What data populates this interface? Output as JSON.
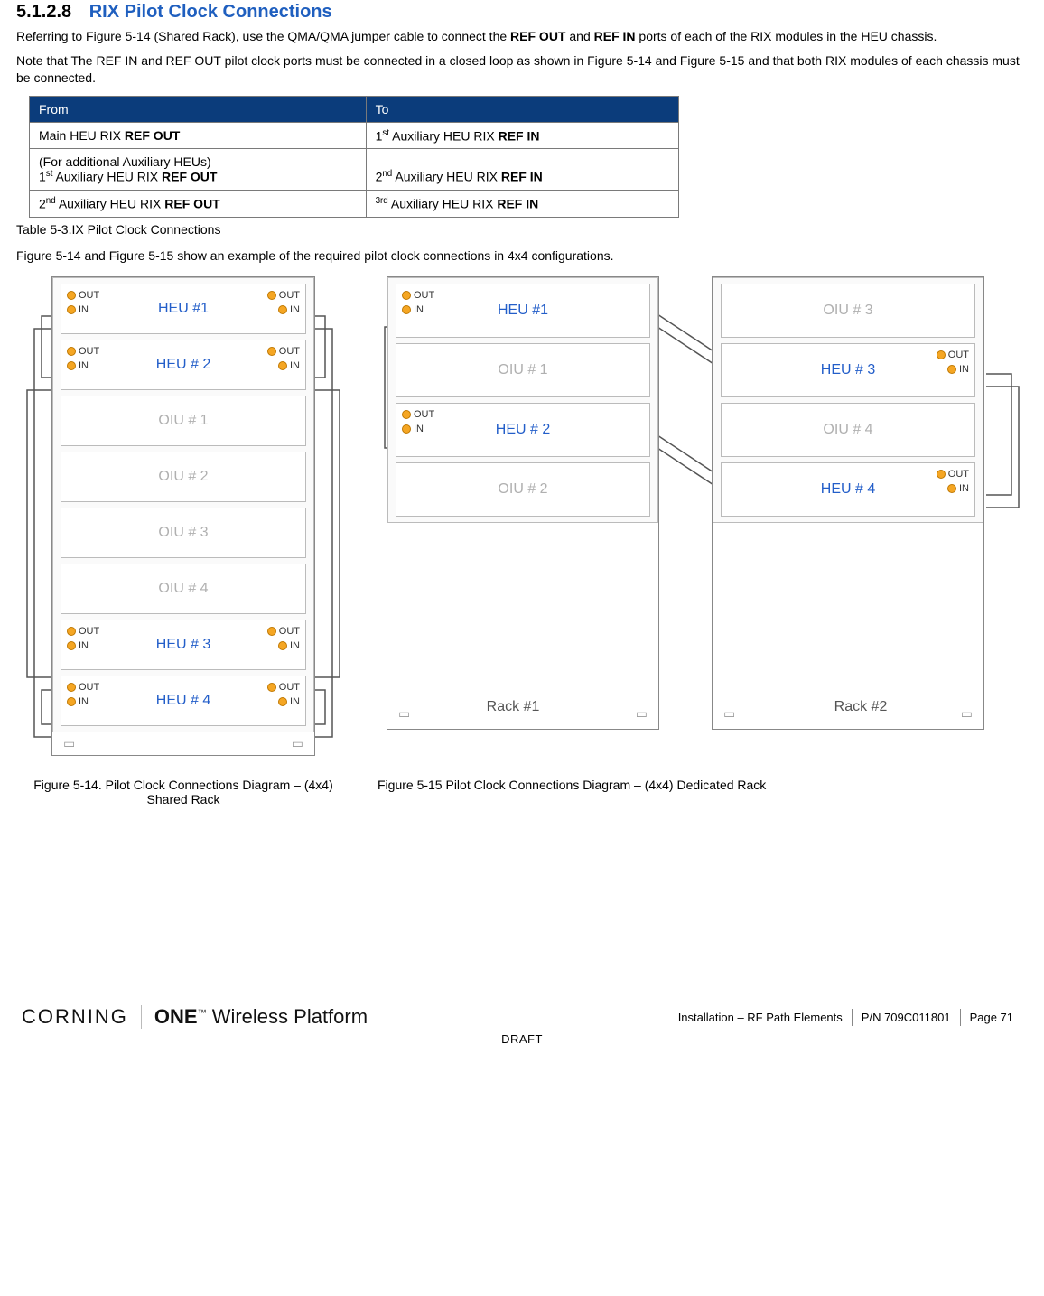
{
  "section": {
    "number": "5.1.2.8",
    "title": "RIX Pilot Clock Connections"
  },
  "para1_a": "Referring to Figure 5-14 (Shared Rack), use the QMA/QMA jumper cable to connect the ",
  "para1_b": " and ",
  "para1_c": " ports of each of the RIX modules in the HEU chassis.",
  "ref_out": "REF OUT",
  "ref_in": "REF IN",
  "para2": "Note that The REF IN and REF OUT pilot clock ports must be connected in a closed loop as shown in Figure 5-14 and Figure 5-15 and that both RIX modules of each chassis must be connected.",
  "table": {
    "headers": [
      "From",
      "To"
    ],
    "rows": [
      {
        "from_pre": "Main HEU RIX ",
        "from_bold": "REF OUT",
        "to_pre": "1",
        "to_sup": "st",
        "to_mid": " Auxiliary HEU RIX ",
        "to_bold": "REF IN"
      },
      {
        "from_line1": "(For additional Auxiliary HEUs)",
        "from_pre": "1",
        "from_sup": "st",
        "from_mid": " Auxiliary HEU RIX ",
        "from_bold": "REF OUT",
        "to_pre": "2",
        "to_sup": "nd",
        "to_mid": " Auxiliary HEU RIX ",
        "to_bold": "REF IN"
      },
      {
        "from_pre": "2",
        "from_sup": "nd",
        "from_mid": " Auxiliary HEU RIX ",
        "from_bold": "REF OUT",
        "to_pre": "",
        "to_sup": "3rd",
        "to_mid": " Auxiliary HEU RIX ",
        "to_bold": "REF IN"
      }
    ]
  },
  "table_caption": "Table 5-3.IX Pilot Clock Connections",
  "para3": "Figure 5-14 and Figure 5-15 show an example of the required pilot clock connections in 4x4 configurations.",
  "port": {
    "out": "OUT",
    "in": "IN"
  },
  "shared_rack_modules": [
    {
      "label": "HEU #1",
      "type": "heu",
      "ports": "both"
    },
    {
      "label": "HEU # 2",
      "type": "heu",
      "ports": "both"
    },
    {
      "label": "OIU # 1",
      "type": "oiu",
      "ports": "none"
    },
    {
      "label": "OIU # 2",
      "type": "oiu",
      "ports": "none"
    },
    {
      "label": "OIU # 3",
      "type": "oiu",
      "ports": "none"
    },
    {
      "label": "OIU # 4",
      "type": "oiu",
      "ports": "none"
    },
    {
      "label": "HEU # 3",
      "type": "heu",
      "ports": "both"
    },
    {
      "label": "HEU # 4",
      "type": "heu",
      "ports": "both"
    }
  ],
  "dedicated": {
    "rack1": {
      "label": "Rack #1",
      "modules": [
        {
          "label": "HEU #1",
          "type": "heu",
          "ports": "left"
        },
        {
          "label": "OIU # 1",
          "type": "oiu",
          "ports": "none"
        },
        {
          "label": "HEU # 2",
          "type": "heu",
          "ports": "left"
        },
        {
          "label": "OIU # 2",
          "type": "oiu",
          "ports": "none"
        }
      ]
    },
    "rack2": {
      "label": "Rack #2",
      "modules": [
        {
          "label": "OIU # 3",
          "type": "oiu",
          "ports": "none"
        },
        {
          "label": "HEU # 3",
          "type": "heu",
          "ports": "right"
        },
        {
          "label": "OIU # 4",
          "type": "oiu",
          "ports": "none"
        },
        {
          "label": "HEU # 4",
          "type": "heu",
          "ports": "right"
        }
      ]
    }
  },
  "fig14_caption": "Figure 5-14. Pilot Clock Connections Diagram – (4x4) Shared Rack",
  "fig15_caption": "Figure 5-15 Pilot Clock Connections Diagram – (4x4) Dedicated Rack",
  "footer": {
    "brand_left": "CORNING",
    "brand_one": "ONE",
    "brand_wp": "Wireless Platform",
    "crumb": "Installation – RF Path Elements",
    "pn": "P/N 709C011801",
    "page": "Page 71",
    "draft": "DRAFT"
  }
}
